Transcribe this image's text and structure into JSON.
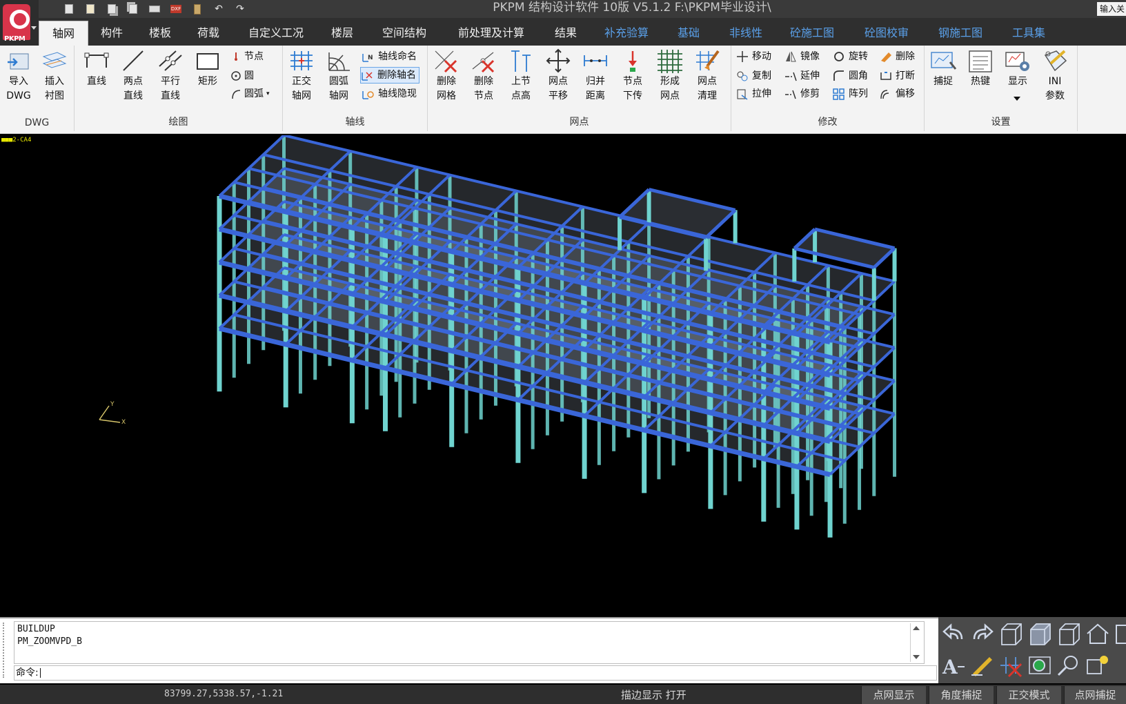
{
  "window": {
    "title": "PKPM 结构设计软件 10版 V5.1.2 F:\\PKPM毕业设计\\",
    "logo_text": "PKPM",
    "search_text": "输入关"
  },
  "quick_access": [
    "save-icon",
    "save-as-icon",
    "save-all-icon",
    "copy-icon",
    "print-icon",
    "dxf-export-icon",
    "book-icon",
    "undo-icon",
    "redo-icon"
  ],
  "tabs": [
    {
      "label": "轴网",
      "active": true
    },
    {
      "label": "构件"
    },
    {
      "label": "楼板"
    },
    {
      "label": "荷载"
    },
    {
      "label": "自定义工况"
    },
    {
      "label": "楼层"
    },
    {
      "label": "空间结构"
    },
    {
      "label": "前处理及计算"
    },
    {
      "label": "结果"
    },
    {
      "label": "补充验算",
      "blue": true
    },
    {
      "label": "基础",
      "blue": true
    },
    {
      "label": "非线性",
      "blue": true
    },
    {
      "label": "砼施工图",
      "blue": true
    },
    {
      "label": "砼图校审",
      "blue": true
    },
    {
      "label": "钢施工图",
      "blue": true
    },
    {
      "label": "工具集",
      "blue": true
    }
  ],
  "ribbon": {
    "dwg": {
      "label": "DWG",
      "import": [
        "导入",
        "DWG"
      ],
      "insert": [
        "插入",
        "衬图"
      ]
    },
    "draw": {
      "label": "绘图",
      "line": "直线",
      "two_point": [
        "两点",
        "直线"
      ],
      "parallel": [
        "平行",
        "直线"
      ],
      "rect": "矩形",
      "node": "节点",
      "circle": "圆",
      "arc": "圆弧"
    },
    "axis": {
      "label": "轴线",
      "ortho": [
        "正交",
        "轴网"
      ],
      "arc_grid": [
        "圆弧",
        "轴网"
      ],
      "name_axis": "轴线命名",
      "delete_axis_name": "删除轴名",
      "hide_axis": "轴线隐现"
    },
    "grid": {
      "label": "网点",
      "delete_grid": [
        "删除",
        "网格"
      ],
      "delete_node": [
        "删除",
        "节点"
      ],
      "upper_node_height": [
        "上节",
        "点高"
      ],
      "node_move": [
        "网点",
        "平移"
      ],
      "merge_distance": [
        "归并",
        "距离"
      ],
      "node_pass_down": [
        "节点",
        "下传"
      ],
      "form_node": [
        "形成",
        "网点"
      ],
      "clean_node": [
        "网点",
        "清理"
      ]
    },
    "modify": {
      "label": "修改",
      "move": "移动",
      "mirror": "镜像",
      "rotate": "旋转",
      "delete": "删除",
      "copy": "复制",
      "extend": "延伸",
      "fillet": "圆角",
      "break": "打断",
      "stretch": "拉伸",
      "trim": "修剪",
      "array": "阵列",
      "offset": "偏移"
    },
    "settings": {
      "label": "设置",
      "snap": "捕捉",
      "hotkey": "热键",
      "display": "显示",
      "ini": [
        "INI",
        "参数"
      ]
    }
  },
  "viewport": {
    "label": "2-CA4",
    "background": "#000000",
    "beam_color": "#3a66d8",
    "column_color": "#6fd3cf",
    "slab_color": "#a8b4c8",
    "axis_labels": [
      "Y",
      "X"
    ]
  },
  "command": {
    "history": [
      "BUILDUP",
      "PM_ZOOMVPD_B"
    ],
    "prompt": "命令:"
  },
  "status": {
    "coords": "83799.27,5338.57,-1.21",
    "edge_display": "描边显示 打开",
    "buttons": [
      "点网显示",
      "角度捕捉",
      "正交模式",
      "点网捕捉"
    ]
  }
}
